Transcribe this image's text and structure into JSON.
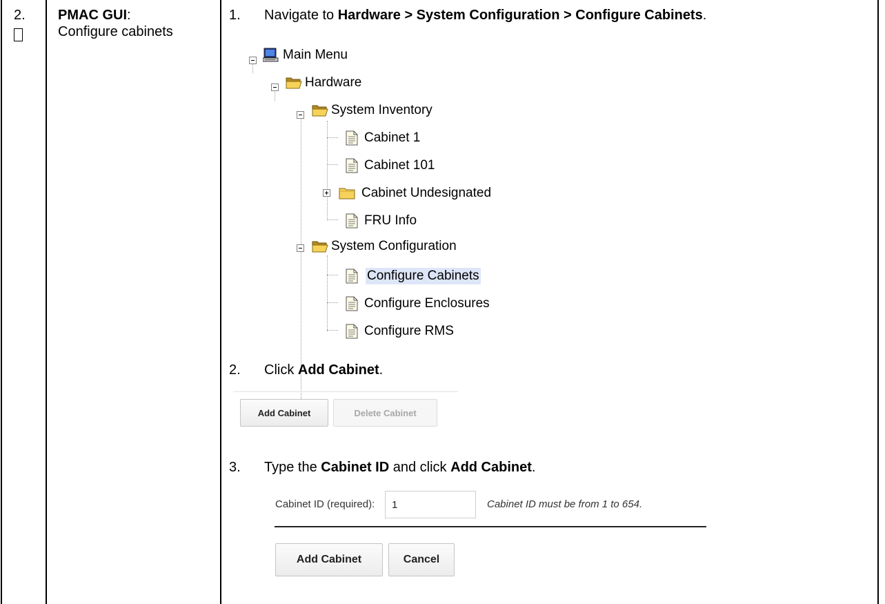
{
  "step": {
    "number": "2.",
    "title_bold": "PMAC GUI",
    "title_colon": ":",
    "subtitle": "Configure cabinets"
  },
  "instructions": [
    {
      "num": "1.",
      "pre": "Navigate to ",
      "bold": "Hardware > System Configuration > Configure Cabinets",
      "post": "."
    },
    {
      "num": "2.",
      "pre": "Click ",
      "bold": "Add Cabinet",
      "post": "."
    },
    {
      "num": "3.",
      "pre": "Type the ",
      "bold": "Cabinet ID",
      "mid": " and click ",
      "bold2": "Add Cabinet",
      "post": "."
    }
  ],
  "tree": {
    "root": "Main Menu",
    "hardware": "Hardware",
    "system_inventory": "System Inventory",
    "inventory_items": [
      "Cabinet 1",
      "Cabinet 101",
      "Cabinet Undesignated",
      "FRU Info"
    ],
    "system_configuration": "System Configuration",
    "configuration_items": [
      "Configure Cabinets",
      "Configure Enclosures",
      "Configure RMS"
    ],
    "selected": "Configure Cabinets"
  },
  "toolbar": {
    "add_label": "Add Cabinet",
    "delete_label": "Delete Cabinet"
  },
  "form": {
    "field_label": "Cabinet ID (required):",
    "field_value": "1",
    "hint": "Cabinet ID must be from 1 to 654.",
    "submit_label": "Add Cabinet",
    "cancel_label": "Cancel"
  }
}
